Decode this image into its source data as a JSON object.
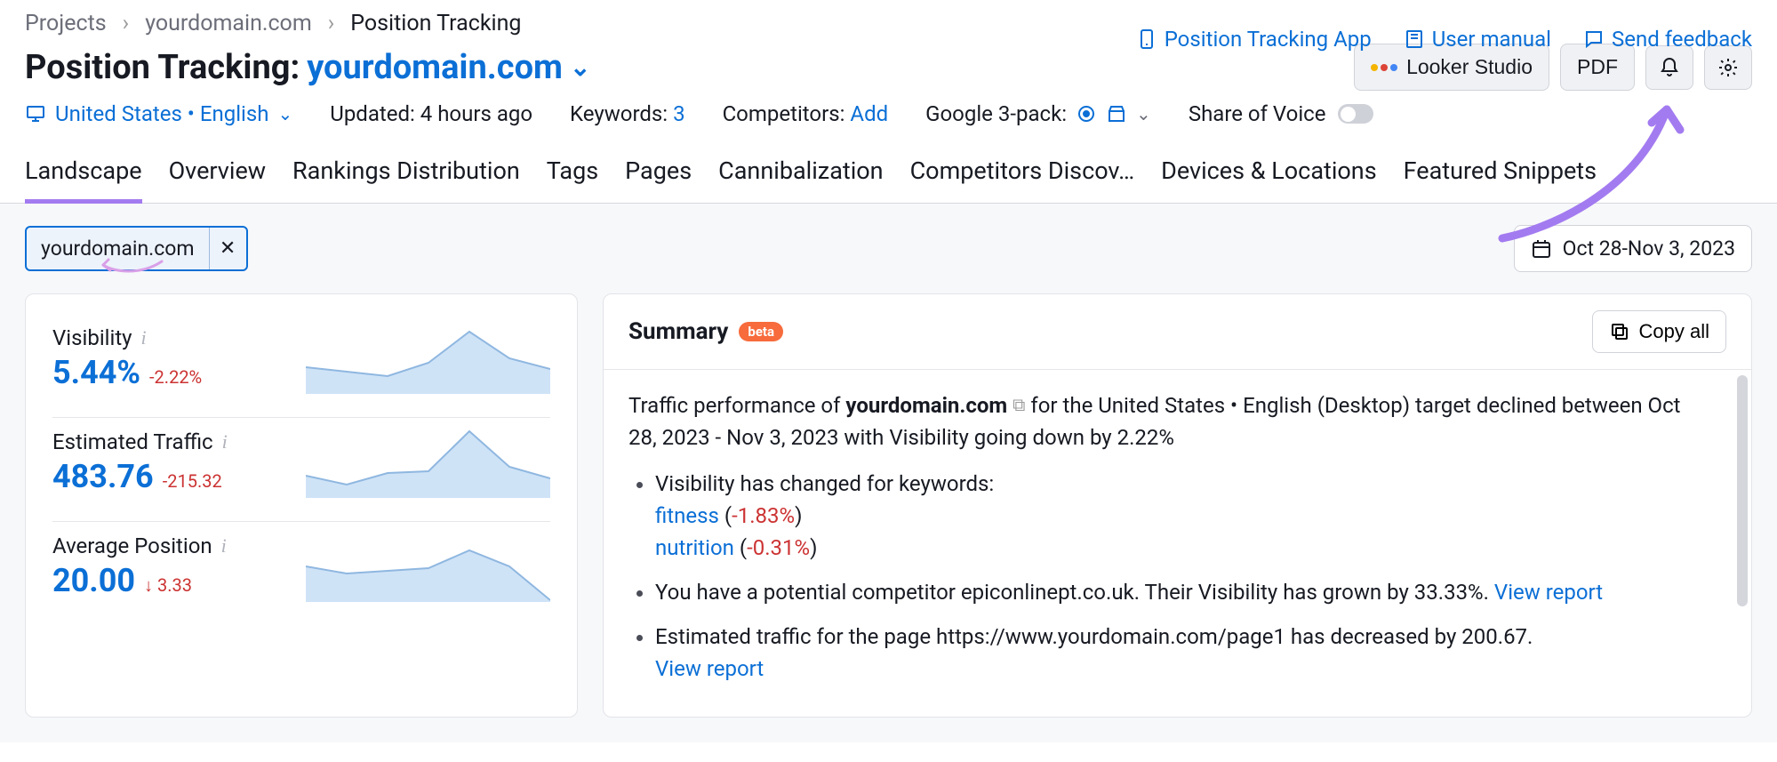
{
  "breadcrumb": {
    "items": [
      "Projects",
      "yourdomain.com",
      "Position Tracking"
    ]
  },
  "top_links": {
    "app": "Position Tracking App",
    "manual": "User manual",
    "feedback": "Send feedback"
  },
  "title": {
    "prefix": "Position Tracking:",
    "domain": "yourdomain.com"
  },
  "actions": {
    "looker": "Looker Studio",
    "pdf": "PDF"
  },
  "settings": {
    "location": "United States • English",
    "updated": "Updated: 4 hours ago",
    "keywords_label": "Keywords:",
    "keywords_value": "3",
    "competitors_label": "Competitors:",
    "competitors_value": "Add",
    "g3pack_label": "Google 3-pack:",
    "sov_label": "Share of Voice"
  },
  "tabs": [
    "Landscape",
    "Overview",
    "Rankings Distribution",
    "Tags",
    "Pages",
    "Cannibalization",
    "Competitors Discov…",
    "Devices & Locations",
    "Featured Snippets"
  ],
  "active_tab": 0,
  "chip": {
    "text": "yourdomain.com",
    "close": "✕"
  },
  "date_range": "Oct 28-Nov 3, 2023",
  "metrics": [
    {
      "label": "Visibility",
      "value": "5.44%",
      "delta": "-2.22%",
      "dir": "neg"
    },
    {
      "label": "Estimated Traffic",
      "value": "483.76",
      "delta": "-215.32",
      "dir": "neg"
    },
    {
      "label": "Average Position",
      "value": "20.00",
      "delta": "↓ 3.33",
      "dir": "neg"
    }
  ],
  "summary": {
    "title": "Summary",
    "badge": "beta",
    "copy": "Copy all",
    "lead_pre": "Traffic performance of ",
    "lead_domain": "yourdomain.com",
    "lead_post": " for the United States • English (Desktop) target declined between Oct 28, 2023 - Nov 3, 2023 with Visibility going down by 2.22%",
    "bullet1_intro": "Visibility has changed for keywords:",
    "bullet1_kw1": "fitness",
    "bullet1_kw1_delta": "-1.83%",
    "bullet1_kw2": "nutrition",
    "bullet1_kw2_delta": "-0.31%",
    "bullet2_text": "You have a potential competitor epiconlinept.co.uk. Their Visibility has grown by 33.33%. ",
    "bullet2_link": "View report",
    "bullet3_text": "Estimated traffic for the page https://www.yourdomain.com/page1 has decreased by 200.67.",
    "bullet3_link": "View report"
  },
  "chart_data": [
    {
      "type": "area",
      "x": [
        0,
        1,
        2,
        3,
        4,
        5,
        6
      ],
      "values": [
        50,
        45,
        40,
        55,
        90,
        60,
        48
      ],
      "ylim": [
        0,
        100
      ]
    },
    {
      "type": "area",
      "x": [
        0,
        1,
        2,
        3,
        4,
        5,
        6
      ],
      "values": [
        45,
        35,
        48,
        50,
        95,
        55,
        42
      ],
      "ylim": [
        0,
        100
      ]
    },
    {
      "type": "area",
      "x": [
        0,
        1,
        2,
        3,
        4,
        5,
        6
      ],
      "values": [
        60,
        52,
        55,
        58,
        78,
        60,
        20
      ],
      "ylim": [
        0,
        100
      ]
    }
  ]
}
